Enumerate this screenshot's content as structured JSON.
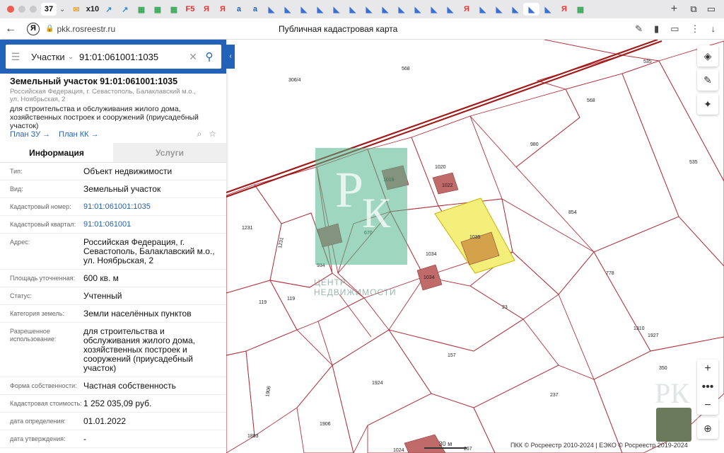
{
  "browser": {
    "tab_count": "37",
    "fav_icons": [
      "mail-icon",
      "x10-icon",
      "chart-icon",
      "chart-icon",
      "apps-icon",
      "apps-icon",
      "apps-icon",
      "f5-icon",
      "ya-icon",
      "ya-icon",
      "a-icon",
      "a-icon",
      "nav-icon",
      "nav-icon",
      "nav-icon",
      "nav-icon",
      "nav-icon",
      "nav-icon",
      "nav-icon",
      "nav-icon",
      "nav-icon",
      "nav-icon",
      "nav-icon",
      "nav-icon",
      "ya-icon",
      "nav-icon",
      "nav-icon",
      "nav-icon",
      "nav-icon",
      "nav-icon",
      "ya-icon",
      "apps-icon"
    ],
    "fav_labels": [
      "✉",
      "x10",
      "↗",
      "↗",
      "▦",
      "▦",
      "▦",
      "F5",
      "Я",
      "Я",
      "a",
      "a",
      "◣",
      "◣",
      "◣",
      "◣",
      "◣",
      "◣",
      "◣",
      "◣",
      "◣",
      "◣",
      "◣",
      "◣",
      "Я",
      "◣",
      "◣",
      "◣",
      "◣",
      "◣",
      "Я",
      "▦"
    ],
    "url": "pkk.rosreestr.ru",
    "page_title": "Публичная кадастровая карта"
  },
  "search": {
    "type_label": "Участки",
    "query": "91:01:061001:1035"
  },
  "object": {
    "title": "Земельный участок 91:01:061001:1035",
    "address_short": "Российская Федерация, г. Севастополь, Балаклавский м.о., ул. Ноябрьская, 2",
    "use_short": "для строительства и обслуживания жилого дома, хозяйственных построек и сооружений (приусадебный участок)",
    "link_plan_zu": "План ЗУ",
    "link_plan_kk": "План КК"
  },
  "tabs": {
    "info": "Информация",
    "services": "Услуги"
  },
  "rows": [
    {
      "label": "Тип:",
      "value": "Объект недвижимости"
    },
    {
      "label": "Вид:",
      "value": "Земельный участок"
    },
    {
      "label": "Кадастровый номер:",
      "value": "91:01:061001:1035"
    },
    {
      "label": "Кадастровый квартал:",
      "value": "91:01:061001"
    },
    {
      "label": "Адрес:",
      "value": "Российская Федерация, г. Севастополь, Балаклавский м.о., ул. Ноябрьская, 2"
    },
    {
      "label": "Площадь уточненная:",
      "value": "600 кв. м"
    },
    {
      "label": "Статус:",
      "value": "Учтенный"
    },
    {
      "label": "Категория земель:",
      "value": "Земли населённых пунктов"
    },
    {
      "label": "Разрешенное использование:",
      "value": "для строительства и обслуживания жилого дома, хозяйственных построек и сооружений (приусадебный участок)"
    },
    {
      "label": "Форма собственности:",
      "value": "Частная собственность"
    },
    {
      "label": "Кадастровая стоимость:",
      "value": "1 252 035,09 руб."
    },
    {
      "label": "дата определения:",
      "value": "01.01.2022"
    },
    {
      "label": "дата утверждения:",
      "value": "-"
    }
  ],
  "map": {
    "parcel_labels": [
      "306/4",
      "568",
      "535",
      "568",
      "980",
      "535",
      "1020",
      "1018",
      "1022",
      "1231",
      "1231",
      "670",
      "854",
      "1035",
      "1034",
      "1034",
      "934",
      "778",
      "119",
      "119",
      "23",
      "1927",
      "1310",
      "157",
      "1924",
      "1906",
      "237",
      "1906",
      "1883",
      "350",
      "267",
      "1024"
    ],
    "watermark_line1": "ЦЕНТР",
    "watermark_line2": "НЕДВИЖИМОСТИ",
    "watermark_logo": "РК",
    "scale": "30 м",
    "copyright": "ПКК © Росреестр 2010-2024 | ЕЭКО © Росреестр 2019-2024",
    "colors": {
      "parcel_line": "#b0303a",
      "boundary": "#a01c1c",
      "selected": "#f3ef7a",
      "building": "#c06a6a"
    }
  }
}
